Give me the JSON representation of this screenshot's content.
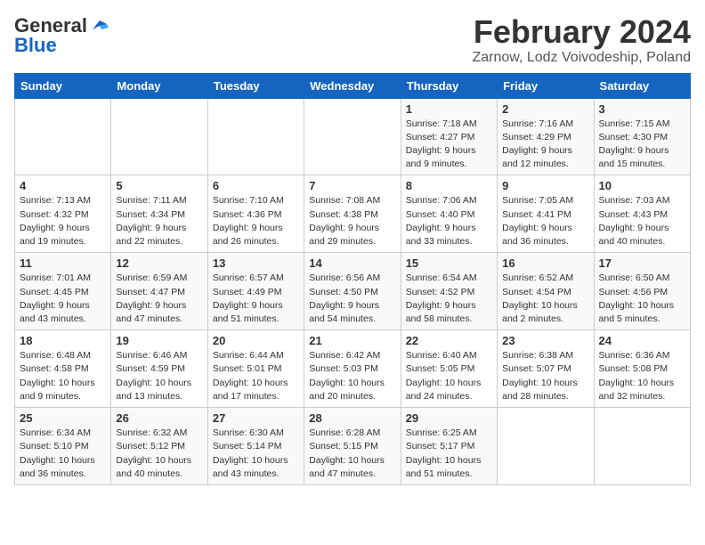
{
  "header": {
    "logo_general": "General",
    "logo_blue": "Blue",
    "month_title": "February 2024",
    "location": "Zarnow, Lodz Voivodeship, Poland"
  },
  "weekdays": [
    "Sunday",
    "Monday",
    "Tuesday",
    "Wednesday",
    "Thursday",
    "Friday",
    "Saturday"
  ],
  "weeks": [
    [
      {
        "day": "",
        "info": ""
      },
      {
        "day": "",
        "info": ""
      },
      {
        "day": "",
        "info": ""
      },
      {
        "day": "",
        "info": ""
      },
      {
        "day": "1",
        "info": "Sunrise: 7:18 AM\nSunset: 4:27 PM\nDaylight: 9 hours\nand 9 minutes."
      },
      {
        "day": "2",
        "info": "Sunrise: 7:16 AM\nSunset: 4:29 PM\nDaylight: 9 hours\nand 12 minutes."
      },
      {
        "day": "3",
        "info": "Sunrise: 7:15 AM\nSunset: 4:30 PM\nDaylight: 9 hours\nand 15 minutes."
      }
    ],
    [
      {
        "day": "4",
        "info": "Sunrise: 7:13 AM\nSunset: 4:32 PM\nDaylight: 9 hours\nand 19 minutes."
      },
      {
        "day": "5",
        "info": "Sunrise: 7:11 AM\nSunset: 4:34 PM\nDaylight: 9 hours\nand 22 minutes."
      },
      {
        "day": "6",
        "info": "Sunrise: 7:10 AM\nSunset: 4:36 PM\nDaylight: 9 hours\nand 26 minutes."
      },
      {
        "day": "7",
        "info": "Sunrise: 7:08 AM\nSunset: 4:38 PM\nDaylight: 9 hours\nand 29 minutes."
      },
      {
        "day": "8",
        "info": "Sunrise: 7:06 AM\nSunset: 4:40 PM\nDaylight: 9 hours\nand 33 minutes."
      },
      {
        "day": "9",
        "info": "Sunrise: 7:05 AM\nSunset: 4:41 PM\nDaylight: 9 hours\nand 36 minutes."
      },
      {
        "day": "10",
        "info": "Sunrise: 7:03 AM\nSunset: 4:43 PM\nDaylight: 9 hours\nand 40 minutes."
      }
    ],
    [
      {
        "day": "11",
        "info": "Sunrise: 7:01 AM\nSunset: 4:45 PM\nDaylight: 9 hours\nand 43 minutes."
      },
      {
        "day": "12",
        "info": "Sunrise: 6:59 AM\nSunset: 4:47 PM\nDaylight: 9 hours\nand 47 minutes."
      },
      {
        "day": "13",
        "info": "Sunrise: 6:57 AM\nSunset: 4:49 PM\nDaylight: 9 hours\nand 51 minutes."
      },
      {
        "day": "14",
        "info": "Sunrise: 6:56 AM\nSunset: 4:50 PM\nDaylight: 9 hours\nand 54 minutes."
      },
      {
        "day": "15",
        "info": "Sunrise: 6:54 AM\nSunset: 4:52 PM\nDaylight: 9 hours\nand 58 minutes."
      },
      {
        "day": "16",
        "info": "Sunrise: 6:52 AM\nSunset: 4:54 PM\nDaylight: 10 hours\nand 2 minutes."
      },
      {
        "day": "17",
        "info": "Sunrise: 6:50 AM\nSunset: 4:56 PM\nDaylight: 10 hours\nand 5 minutes."
      }
    ],
    [
      {
        "day": "18",
        "info": "Sunrise: 6:48 AM\nSunset: 4:58 PM\nDaylight: 10 hours\nand 9 minutes."
      },
      {
        "day": "19",
        "info": "Sunrise: 6:46 AM\nSunset: 4:59 PM\nDaylight: 10 hours\nand 13 minutes."
      },
      {
        "day": "20",
        "info": "Sunrise: 6:44 AM\nSunset: 5:01 PM\nDaylight: 10 hours\nand 17 minutes."
      },
      {
        "day": "21",
        "info": "Sunrise: 6:42 AM\nSunset: 5:03 PM\nDaylight: 10 hours\nand 20 minutes."
      },
      {
        "day": "22",
        "info": "Sunrise: 6:40 AM\nSunset: 5:05 PM\nDaylight: 10 hours\nand 24 minutes."
      },
      {
        "day": "23",
        "info": "Sunrise: 6:38 AM\nSunset: 5:07 PM\nDaylight: 10 hours\nand 28 minutes."
      },
      {
        "day": "24",
        "info": "Sunrise: 6:36 AM\nSunset: 5:08 PM\nDaylight: 10 hours\nand 32 minutes."
      }
    ],
    [
      {
        "day": "25",
        "info": "Sunrise: 6:34 AM\nSunset: 5:10 PM\nDaylight: 10 hours\nand 36 minutes."
      },
      {
        "day": "26",
        "info": "Sunrise: 6:32 AM\nSunset: 5:12 PM\nDaylight: 10 hours\nand 40 minutes."
      },
      {
        "day": "27",
        "info": "Sunrise: 6:30 AM\nSunset: 5:14 PM\nDaylight: 10 hours\nand 43 minutes."
      },
      {
        "day": "28",
        "info": "Sunrise: 6:28 AM\nSunset: 5:15 PM\nDaylight: 10 hours\nand 47 minutes."
      },
      {
        "day": "29",
        "info": "Sunrise: 6:25 AM\nSunset: 5:17 PM\nDaylight: 10 hours\nand 51 minutes."
      },
      {
        "day": "",
        "info": ""
      },
      {
        "day": "",
        "info": ""
      }
    ]
  ]
}
